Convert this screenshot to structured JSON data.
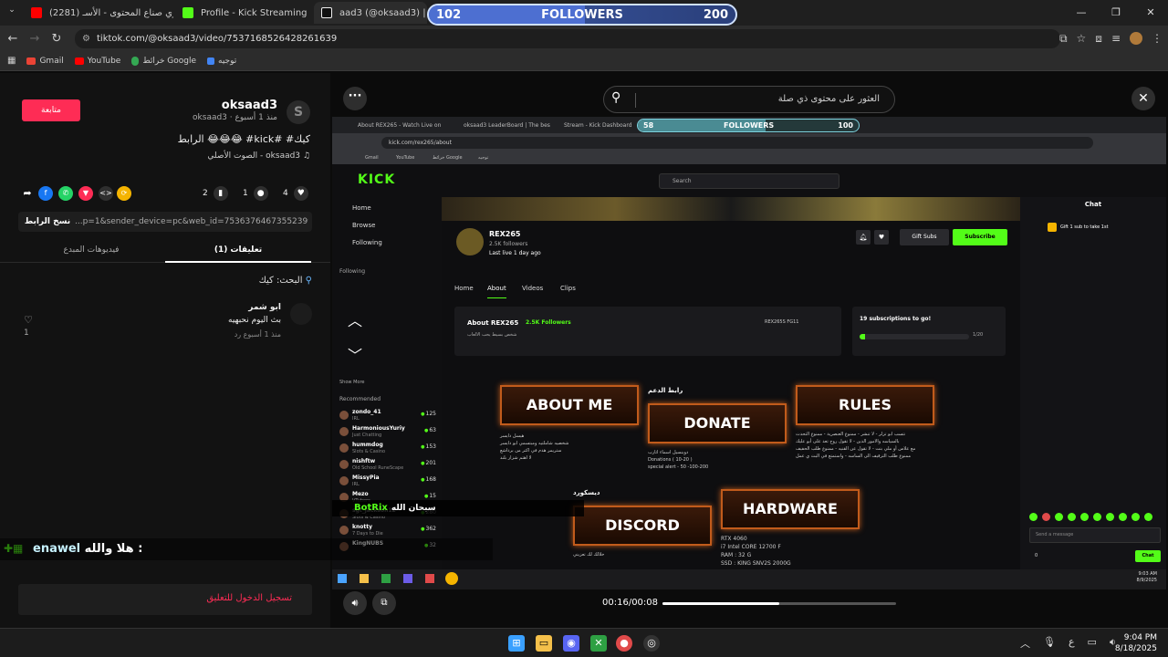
{
  "browser": {
    "tabs": [
      {
        "title": "دوري صناع المحتوى - الأسـ (2281)",
        "favicon_color": "#ff0000"
      },
      {
        "title": "Profile - Kick Streaming",
        "favicon_color": "#53fc18"
      },
      {
        "title": "aad3 (@oksaad3) | TikTok",
        "favicon_color": "#ffffff"
      }
    ],
    "url": "tiktok.com/@oksaad3/video/7537168526428261639",
    "bookmarks": [
      "Gmail",
      "YouTube",
      "خرائط Google",
      "توجيه"
    ],
    "window_controls": [
      "—",
      "❐",
      "✕"
    ]
  },
  "followers_overlay": {
    "current": "102",
    "label": "FOLLOWERS",
    "goal": "200",
    "progress": 0.51
  },
  "tiktok": {
    "follow_label": "متابعة",
    "username": "oksaad3",
    "subline": "oksaad3 · منذ 1 أسبوع",
    "avatar_letter": "S",
    "caption": "الرابط 😂😂😂 #kick# #كيك",
    "sound": "الصوت الأصلي - oksaad3",
    "likes": "4",
    "comments": "1",
    "saves": "2",
    "copy_link_label": "نسخ الرابط",
    "link_text": "...p=1&sender_device=pc&web_id=7536376467355239944",
    "tab_creator": "فيديوهات المبدع",
    "tab_comments": "(1) تعليقات",
    "search_label": "البحث: كيك",
    "comment": {
      "name": "ابو شمر",
      "text": "بث اليوم نحبهيه",
      "meta": "منذ 1 أسبوع    رد",
      "likes": "1"
    },
    "login_prompt": "تسجيل الدخول للتعليق",
    "search_placeholder": "العثور على محتوى ذي صلة",
    "timecode": "00:16/00:08",
    "seek_progress": 0.5
  },
  "inner_screen": {
    "tabs": [
      "About REX265 - Watch Live on",
      "oksaad3 LeaderBoard | The bes",
      "Stream - Kick Dashboard"
    ],
    "followers": {
      "current": "58",
      "label": "FOLLOWERS",
      "goal": "100",
      "progress": 0.58
    },
    "url": "kick.com/rex265/about",
    "bookmarks": [
      "Gmail",
      "YouTube",
      "خرائط Google",
      "توجيه"
    ],
    "kick_logo": "KICK",
    "search_placeholder": "Search",
    "sidebar": {
      "nav": [
        "Home",
        "Browse",
        "Following"
      ],
      "following_heading": "Following",
      "show_more": "Show More",
      "recommended_heading": "Recommended",
      "recommended": [
        {
          "name": "zondo_41",
          "sub": "IRL",
          "viewers": "125"
        },
        {
          "name": "HarmoniousYuriy",
          "sub": "Just Chatting",
          "viewers": "63"
        },
        {
          "name": "hummdog",
          "sub": "Slots & Casino",
          "viewers": "153"
        },
        {
          "name": "nishftw",
          "sub": "Old School RuneScape",
          "viewers": "201"
        },
        {
          "name": "MissyPia",
          "sub": "IRL",
          "viewers": "168"
        },
        {
          "name": "Mezo",
          "sub": "VTubers",
          "viewers": "15"
        },
        {
          "name": "sgt_jackson12",
          "sub": "Slots & Casino",
          "viewers": "280"
        },
        {
          "name": "knotty",
          "sub": "7 Days to Die",
          "viewers": "362"
        },
        {
          "name": "KingNUBS",
          "sub": "",
          "viewers": "32"
        }
      ]
    },
    "channel": {
      "name": "REX265",
      "followers": "2.5K followers",
      "last_live": "Last live 1 day ago",
      "gift_subs": "Gift Subs",
      "subscribe": "Subscribe",
      "tabs": [
        "Home",
        "About",
        "Videos",
        "Clips"
      ],
      "about_title": "About REX265",
      "about_followers": "2.5K Followers",
      "about_desc": "شخص بسيط يحب الالعاب",
      "about_social": "REX265S    FG11",
      "goal_text": "19 subscriptions to go!",
      "goal_count": "1/20",
      "goal_progress": 0.05
    },
    "panels": {
      "about_me": "ABOUT ME",
      "donate": "DONATE",
      "rules": "RULES",
      "discord": "DISCORD",
      "hardware": "HARDWARE",
      "donate_head": "رابط الدعم",
      "discord_head": "ديسكورد",
      "about_text": "هيسل دايسر\nشخصيه شاملتيه ومبتسمي ابو دايسر\nستريمر هدم في اكتر من برداشع\nلا اهتم شزار بلند",
      "donate_text": "دوينسيل اسماء اثارب\nDonations ( 10-20 )\nspecial alert - 50 -100-200",
      "rules_text": "نتسب ابو تزلر - لا تنشر - ممنوع العنصرية - ممنوع التحدث\nبالسياسه والامور الدين - لا تقول روح تعد على أبو عليك\nمع علاس أو ملي بنت - لا تقول عن القنيه - ممنوع طلب الحفيف\nممنوع طلب الترقيف الى الساسه - واستمتع في البث ي عمل",
      "discord_text": "خلالك لك تعزيني",
      "hardware_text": "RTX 4060\ni7 Intel CORE 12700 F\nRAM : 32 G\nSSD : KING SNV2S 2000G"
    },
    "chat": {
      "title": "Chat",
      "gift_notice": "Gift 1 sub to take 1st",
      "input_placeholder": "Send a message",
      "send_label": "Chat",
      "user_count": "0"
    },
    "taskbar_time": "9:03 AM\n8/9/2025"
  },
  "overlays": {
    "botrix": "BotRix",
    "botrix_text": "سبحان الله",
    "chat_user": "enawel",
    "chat_message": "هلا والله :"
  },
  "taskbar": {
    "time": "9:04 PM",
    "date": "8/18/2025",
    "lang": "ع"
  }
}
